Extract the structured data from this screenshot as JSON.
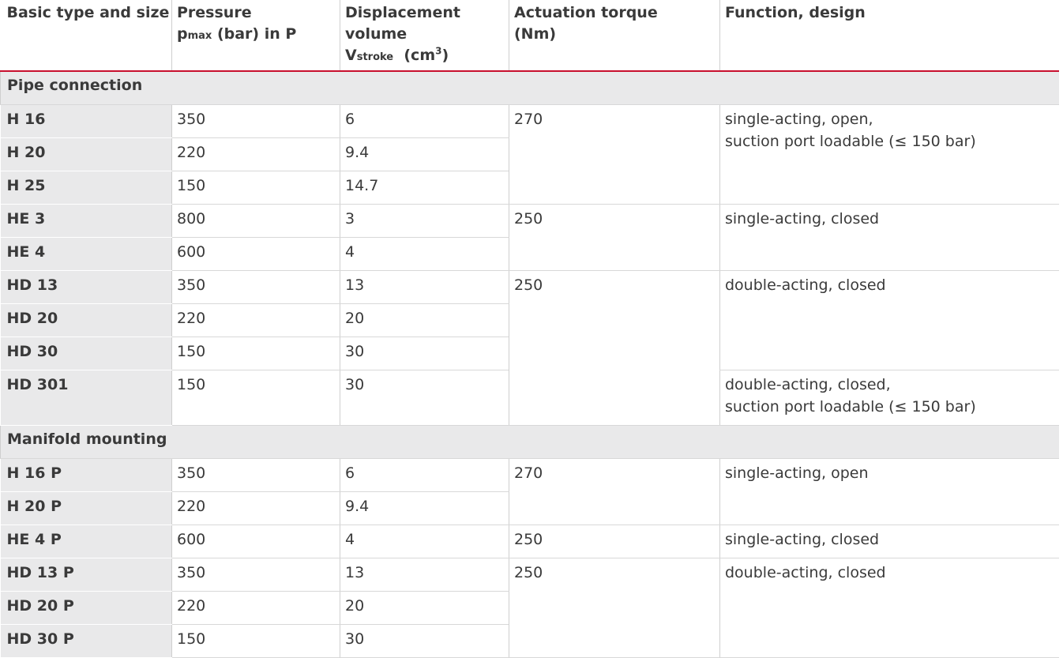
{
  "headers": {
    "type": "Basic type and size",
    "pressure_line1": "Pressure",
    "pressure_p": "p",
    "pressure_sub": "max",
    "pressure_rest": " (bar) in P",
    "displacement_line1": "Displacement",
    "displacement_line2": "volume",
    "displacement_v": "V",
    "displacement_sub": "stroke",
    "displacement_unit": "  (cm",
    "displacement_sup": "3",
    "displacement_close": ")",
    "torque_line1": "Actuation torque",
    "torque_line2": "(Nm)",
    "function": "Function, design"
  },
  "sections": [
    {
      "title": "Pipe connection",
      "rows": [
        {
          "type": "H 16",
          "pressure": "350",
          "volume": "6"
        },
        {
          "type": "H 20",
          "pressure": "220",
          "volume": "9.4"
        },
        {
          "type": "H 25",
          "pressure": "150",
          "volume": "14.7"
        },
        {
          "type": "HE 3",
          "pressure": "800",
          "volume": "3"
        },
        {
          "type": "HE 4",
          "pressure": "600",
          "volume": "4"
        },
        {
          "type": "HD 13",
          "pressure": "350",
          "volume": "13"
        },
        {
          "type": "HD 20",
          "pressure": "220",
          "volume": "20"
        },
        {
          "type": "HD 30",
          "pressure": "150",
          "volume": "30"
        },
        {
          "type": "HD 301",
          "pressure": "150",
          "volume": "30"
        }
      ],
      "torque_groups": [
        "270",
        "250",
        "250"
      ],
      "function_groups": [
        {
          "line1": "single-acting, open,",
          "line2": "suction port loadable (≤ 150 bar)"
        },
        {
          "line1": "single-acting, closed",
          "line2": ""
        },
        {
          "line1": "double-acting, closed",
          "line2": ""
        },
        {
          "line1": "double-acting, closed,",
          "line2": "suction port loadable (≤ 150 bar)"
        }
      ]
    },
    {
      "title": "Manifold mounting",
      "rows": [
        {
          "type": "H 16 P",
          "pressure": "350",
          "volume": "6"
        },
        {
          "type": "H 20 P",
          "pressure": "220",
          "volume": "9.4"
        },
        {
          "type": "HE 4 P",
          "pressure": "600",
          "volume": "4"
        },
        {
          "type": "HD 13 P",
          "pressure": "350",
          "volume": "13"
        },
        {
          "type": "HD 20 P",
          "pressure": "220",
          "volume": "20"
        },
        {
          "type": "HD 30 P",
          "pressure": "150",
          "volume": "30"
        }
      ],
      "torque_groups": [
        "270",
        "250",
        "250"
      ],
      "function_groups": [
        {
          "line1": "single-acting, open",
          "line2": ""
        },
        {
          "line1": "single-acting, closed",
          "line2": ""
        },
        {
          "line1": "double-acting, closed",
          "line2": ""
        }
      ]
    }
  ],
  "colors": {
    "accent_line": "#c8102e",
    "label_bg": "#e9e9ea"
  }
}
